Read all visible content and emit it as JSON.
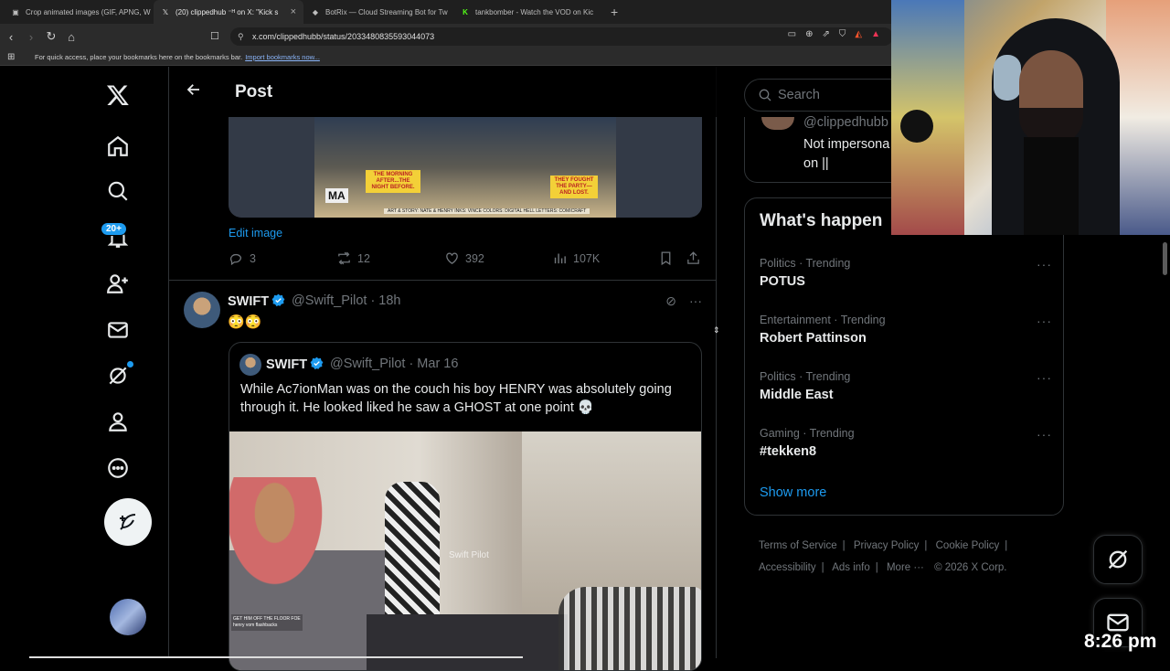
{
  "browser": {
    "tabs": [
      {
        "title": "Crop animated images (GIF, APNG, W",
        "active": false,
        "favicon": "image-icon"
      },
      {
        "title": "(20) clippedhub ⁻ᴴ on X: \"Kick s",
        "active": true,
        "favicon": "x-logo-icon"
      },
      {
        "title": "BotRix — Cloud Streaming Bot for Tw",
        "active": false,
        "favicon": "botrix-icon"
      },
      {
        "title": "tankbomber - Watch the VOD on Kic",
        "active": false,
        "favicon": "kick-icon"
      }
    ],
    "new_tab": "+",
    "url": "x.com/clippedhubb/status/2033480835593044073",
    "bookmarks_hint": "For quick access, place your bookmarks here on the bookmarks bar.",
    "import_link": "Import bookmarks now..."
  },
  "nav": {
    "notifications_badge": "20+",
    "items": [
      "home",
      "explore",
      "notifications",
      "follow",
      "messages",
      "grok",
      "profile",
      "more"
    ]
  },
  "header": {
    "title": "Post"
  },
  "comic": {
    "caption1": "THE MORNING AFTER...THE NIGHT BEFORE.",
    "caption2": "THEY FOUGHT THE PARTY— AND LOST.",
    "publisher": "MA",
    "credits": "ART & STORY: NATE & HENRY   INKS: VINCE   COLORS: DIGITAL HELL   LETTERS: COMICRAFT"
  },
  "edit_image": "Edit image",
  "actions": {
    "replies": "3",
    "reposts": "12",
    "likes": "392",
    "views": "107K"
  },
  "tweet": {
    "name": "SWIFT",
    "handle": "@Swift_Pilot · 18h",
    "text": "😳😳"
  },
  "quote": {
    "name": "SWIFT",
    "handle": "@Swift_Pilot · Mar 16",
    "text": "While Ac7ionMan was on the couch his boy HENRY was absolutely going through it. He looked liked he saw a GHOST at one point 💀",
    "watermark": "Swift Pilot",
    "chat": "GET HIM OFF THE FLOOR FOE\nhenry vom flashbacks"
  },
  "search": {
    "placeholder": "Search"
  },
  "mini_card": {
    "handle": "@clippedhubb",
    "bio": "Not impersona on ||"
  },
  "trends": {
    "title": "What's happen",
    "items": [
      {
        "category": "Politics · Trending",
        "name": "POTUS"
      },
      {
        "category": "Entertainment · Trending",
        "name": "Robert Pattinson"
      },
      {
        "category": "Politics · Trending",
        "name": "Middle East"
      },
      {
        "category": "Gaming · Trending",
        "name": "#tekken8"
      }
    ],
    "show_more": "Show more"
  },
  "footer": {
    "terms": "Terms of Service",
    "privacy": "Privacy Policy",
    "cookie": "Cookie Policy",
    "accessibility": "Accessibility",
    "ads": "Ads info",
    "more": "More ···",
    "copyright": "© 2026 X Corp."
  },
  "overlay": {
    "clock": "8:26 pm"
  },
  "colors": {
    "accent": "#1d9bf0",
    "background": "#000000",
    "border": "#2f3336",
    "muted": "#71767b"
  }
}
